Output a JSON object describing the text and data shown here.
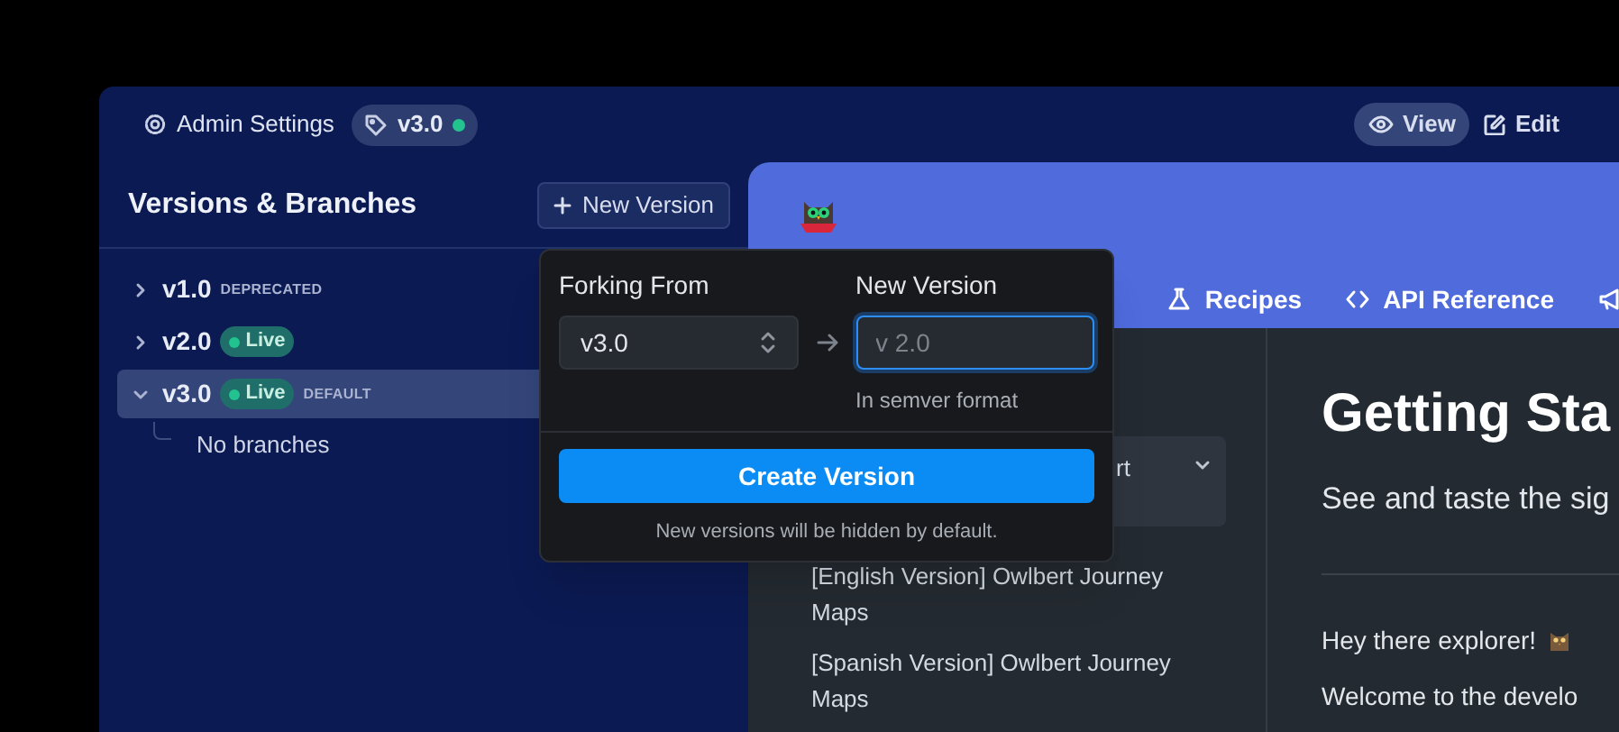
{
  "top_bar": {
    "title": "Admin Settings",
    "version_pill": {
      "label": "v3.0",
      "live": true
    },
    "modes": [
      {
        "label": "View",
        "selected": true
      },
      {
        "label": "Edit",
        "selected": false
      }
    ]
  },
  "versions_panel": {
    "title": "Versions & Branches",
    "new_button": "New Version",
    "tree": [
      {
        "label": "v1.0",
        "expanded": false,
        "selected": false,
        "tag": "DEPRECATED"
      },
      {
        "label": "v2.0",
        "expanded": false,
        "selected": false,
        "live_badge": "Live"
      },
      {
        "label": "v3.0",
        "expanded": true,
        "selected": true,
        "live_badge": "Live",
        "tag": "DEFAULT",
        "empty_text": "No branches"
      }
    ]
  },
  "popover": {
    "from_label": "Forking From",
    "from_value": "v3.0",
    "new_label": "New Version",
    "new_placeholder": "v 2.0",
    "hint": "In semver format",
    "create_button": "Create Version",
    "note": "New versions will be hidden by default."
  },
  "preview": {
    "nav": [
      {
        "kind": "link",
        "label": "Recipes"
      },
      {
        "kind": "link",
        "label": "API Reference"
      },
      {
        "kind": "icon"
      }
    ],
    "sidebar": [
      {
        "label": "rt",
        "expanded": true,
        "selected": true
      },
      {
        "label": "[English Version] Owlbert Journey Maps",
        "selected": false
      },
      {
        "label": "[Spanish Version] Owlbert Journey Maps",
        "selected": false
      }
    ],
    "heading": "Getting Sta",
    "subtitle": "See and taste the sig",
    "greeting": "Hey there explorer!",
    "body": "Welcome to the develo"
  }
}
